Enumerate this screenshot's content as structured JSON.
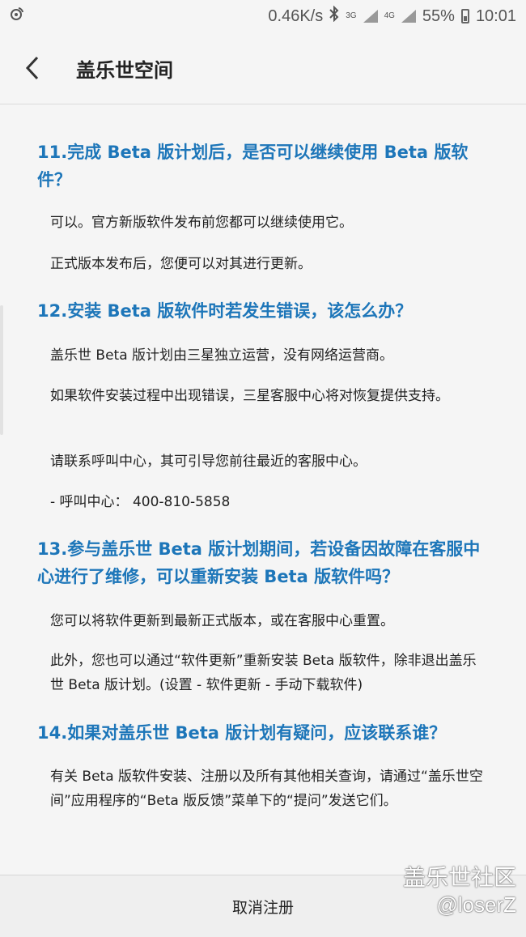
{
  "status_bar": {
    "speed": "0.46K/s",
    "net1": "3G",
    "net2": "4G",
    "battery": "55%",
    "time": "10:01"
  },
  "header": {
    "title": "盖乐世空间"
  },
  "faq": [
    {
      "question": "11.完成 Beta 版计划后，是否可以继续使用 Beta 版软件？",
      "answers": [
        "可以。官方新版软件发布前您都可以继续使用它。",
        "正式版本发布后，您便可以对其进行更新。"
      ]
    },
    {
      "question": "12.安装 Beta 版软件时若发生错误，该怎么办？",
      "answers": [
        "盖乐世 Beta 版计划由三星独立运营，没有网络运营商。",
        "如果软件安装过程中出现错误，三星客服中心将对恢复提供支持。",
        "请联系呼叫中心，其可引导您前往最近的客服中心。",
        "- 呼叫中心： 400-810-5858"
      ]
    },
    {
      "question": "13.参与盖乐世 Beta 版计划期间，若设备因故障在客服中心进行了维修，可以重新安装 Beta 版软件吗？",
      "answers": [
        "您可以将软件更新到最新正式版本，或在客服中心重置。",
        "此外，您也可以通过“软件更新”重新安装 Beta 版软件，除非退出盖乐世 Beta 版计划。(设置 - 软件更新 - 手动下载软件)"
      ]
    },
    {
      "question": "14.如果对盖乐世 Beta 版计划有疑问，应该联系谁？",
      "answers": [
        "有关 Beta 版软件安装、注册以及所有其他相关查询，请通过“盖乐世空间”应用程序的“Beta 版反馈”菜单下的“提问”发送它们。"
      ]
    }
  ],
  "footer": {
    "cancel_label": "取消注册"
  },
  "watermark": {
    "line1": "盖乐世社区",
    "line2": "@loserZ"
  }
}
